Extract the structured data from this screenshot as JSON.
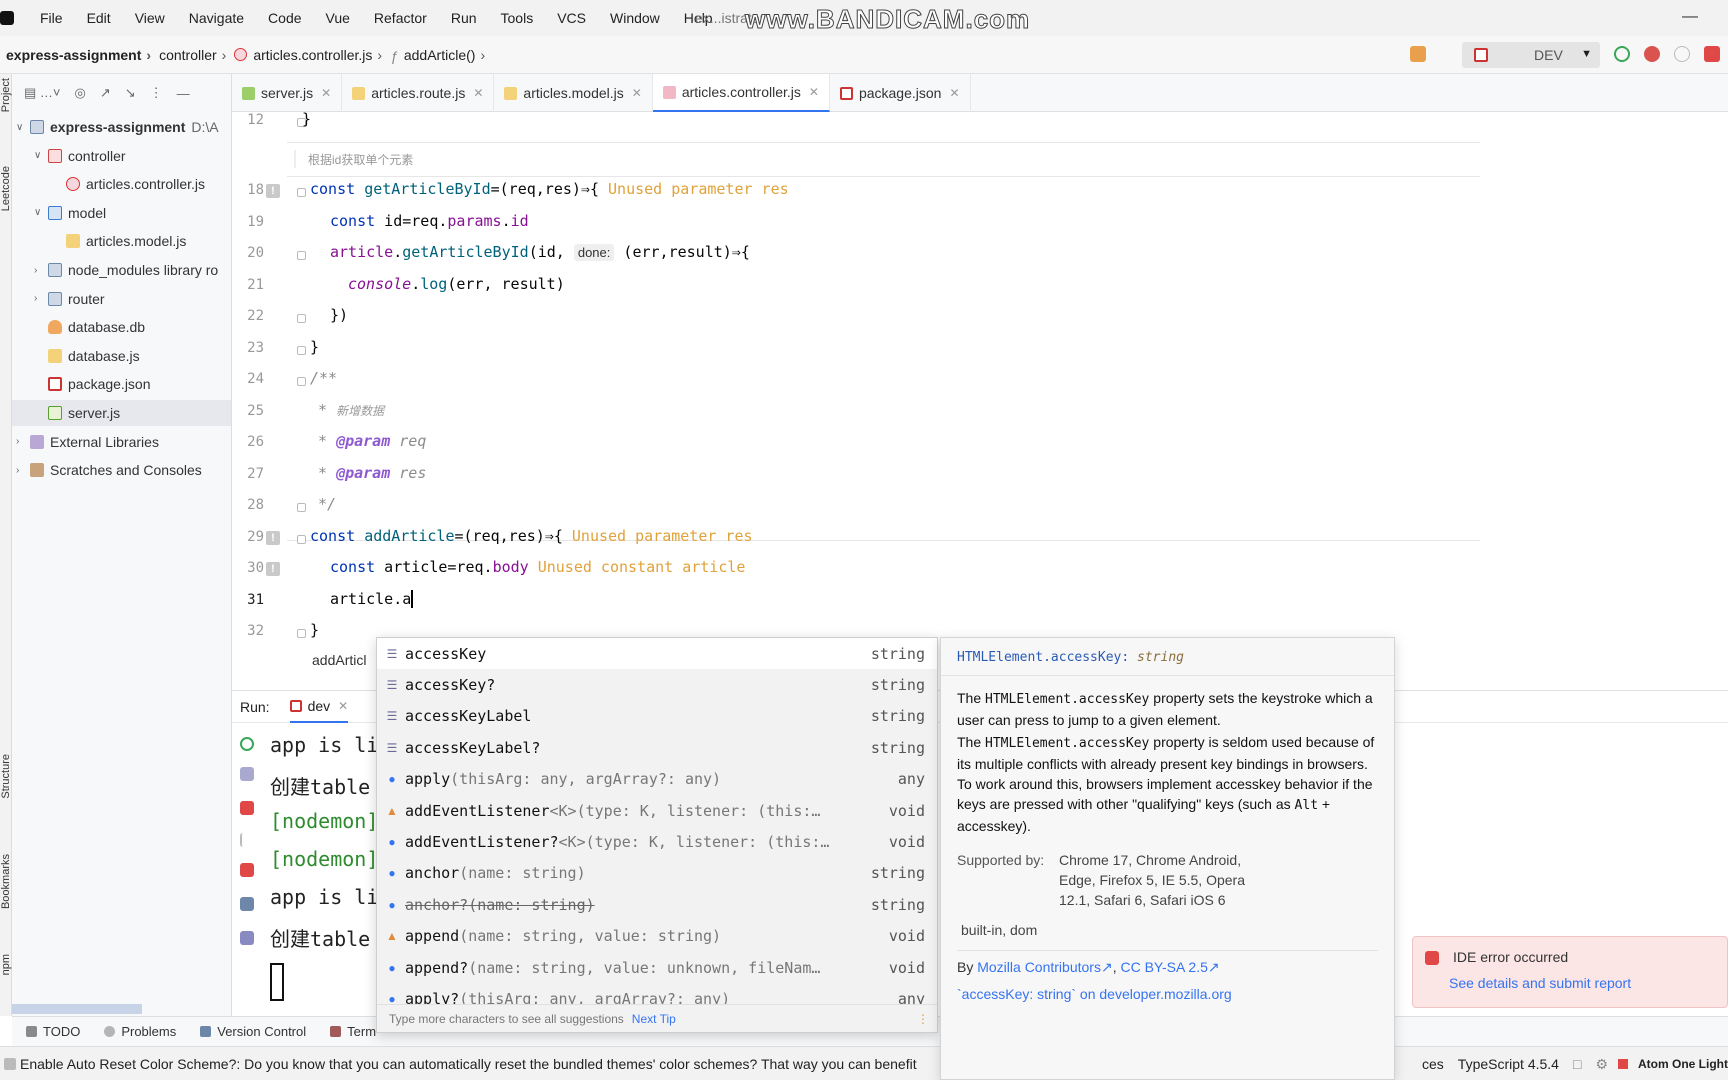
{
  "menu": [
    "File",
    "Edit",
    "View",
    "Navigate",
    "Code",
    "Vue",
    "Refactor",
    "Run",
    "Tools",
    "VCS",
    "Window",
    "Help"
  ],
  "window_title": "ex...istrator",
  "watermark": "www.BANDICAM.com",
  "breadcrumb": {
    "project": "express-assignment",
    "folder": "controller",
    "file": "articles.controller.js",
    "symbol": "addArticle()"
  },
  "run_config": "DEV",
  "project_tree": [
    {
      "label": "express-assignment",
      "suffix": "D:\\A",
      "depth": 0,
      "arrow": "open",
      "icon": "folder"
    },
    {
      "label": "controller",
      "depth": 1,
      "arrow": "open",
      "icon": "folder-red"
    },
    {
      "label": "articles.controller.js",
      "depth": 2,
      "arrow": "",
      "icon": "ng"
    },
    {
      "label": "model",
      "depth": 1,
      "arrow": "open",
      "icon": "folder-blue"
    },
    {
      "label": "articles.model.js",
      "depth": 2,
      "arrow": "",
      "icon": "js"
    },
    {
      "label": "node_modules  library ro",
      "depth": 1,
      "arrow": "closed",
      "icon": "folder"
    },
    {
      "label": "router",
      "depth": 1,
      "arrow": "closed",
      "icon": "folder"
    },
    {
      "label": "database.db",
      "depth": 1,
      "arrow": "",
      "icon": "db"
    },
    {
      "label": "database.js",
      "depth": 1,
      "arrow": "",
      "icon": "js"
    },
    {
      "label": "package.json",
      "depth": 1,
      "arrow": "",
      "icon": "json"
    },
    {
      "label": "server.js",
      "depth": 1,
      "arrow": "",
      "icon": "node"
    },
    {
      "label": "External Libraries",
      "depth": 0,
      "arrow": "closed",
      "icon": "lib"
    },
    {
      "label": "Scratches and Consoles",
      "depth": 0,
      "arrow": "closed",
      "icon": "scr"
    }
  ],
  "left_strip_tabs": [
    "Project",
    "Leetcode",
    "Structure",
    "Bookmarks",
    "npm"
  ],
  "tabs": [
    {
      "label": "server.js",
      "active": false
    },
    {
      "label": "articles.route.js",
      "active": false
    },
    {
      "label": "articles.model.js",
      "active": false
    },
    {
      "label": "articles.controller.js",
      "active": true
    },
    {
      "label": "package.json",
      "active": false
    }
  ],
  "editor": {
    "line_numbers": [
      "12",
      "18",
      "19",
      "20",
      "21",
      "22",
      "23",
      "24",
      "25",
      "26",
      "27",
      "28",
      "29",
      "30",
      "31",
      "32"
    ],
    "comment_cn": "根据id获取单个元素",
    "inlay_done": "done:",
    "hint_unused_res": "Unused parameter res",
    "hint_unused_article": "Unused constant article",
    "doc_cn": "新增数据",
    "breadcrumb_bottom": "addArticl"
  },
  "run": {
    "label": "Run:",
    "tab": "dev",
    "lines": [
      "app is li",
      "创建table",
      "[nodemon]",
      "[nodemon]",
      "app is li",
      "创建table"
    ]
  },
  "completion": {
    "items": [
      {
        "name": "accessKey",
        "tail": "",
        "type": "string",
        "icon": "prop",
        "selected": true
      },
      {
        "name": "accessKey?",
        "tail": "",
        "type": "string",
        "icon": "prop"
      },
      {
        "name": "accessKeyLabel",
        "tail": "",
        "type": "string",
        "icon": "prop"
      },
      {
        "name": "accessKeyLabel?",
        "tail": "",
        "type": "string",
        "icon": "prop"
      },
      {
        "name": "apply",
        "tail": "(thisArg: any, argArray?: any)",
        "type": "any",
        "icon": "method"
      },
      {
        "name": "addEventListener",
        "tail": "<K>(type: K, listener: (this:…",
        "type": "void",
        "icon": "warn"
      },
      {
        "name": "addEventListener?",
        "tail": "<K>(type: K, listener: (this:…",
        "type": "void",
        "icon": "method"
      },
      {
        "name": "anchor",
        "tail": "(name: string)",
        "type": "string",
        "icon": "method"
      },
      {
        "name": "anchor?",
        "tail": "(name: string)",
        "type": "string",
        "icon": "method",
        "strike": true
      },
      {
        "name": "append",
        "tail": "(name: string, value: string)",
        "type": "void",
        "icon": "warn"
      },
      {
        "name": "append?",
        "tail": "(name: string, value: unknown, fileNam…",
        "type": "void",
        "icon": "method"
      },
      {
        "name": "apply?",
        "tail": "(thisArg: any, argArray?: any)",
        "type": "any",
        "icon": "method"
      }
    ],
    "footer": "Type more characters to see all suggestions",
    "tip": "Next Tip"
  },
  "doc": {
    "signature": "HTMLElement.accessKey:",
    "signature_type": "string",
    "para1_pre": "The ",
    "para1_code": "HTMLElement.accessKey",
    "para1_post": " property sets the keystroke which a user can press to jump to a given element.",
    "para2_pre": "The ",
    "para2_code": "HTMLElement.accessKey",
    "para2_post": " property is seldom used because of its multiple conflicts with already present key bindings in browsers. To work around this, browsers implement accesskey behavior if the keys are pressed with other \"qualifying\" keys (such as ",
    "para2_code2": "Alt",
    "para2_end": " + accesskey).",
    "supported_label": "Supported by:",
    "supported_value": "Chrome 17, Chrome Android, Edge, Firefox 5, IE 5.5, Opera 12.1, Safari 6, Safari iOS 6",
    "tags": "built-in, dom",
    "by_label": "By",
    "contributors": "Mozilla Contributors",
    "license": "CC BY-SA 2.5",
    "mdn_link": "`accessKey: string` on developer.mozilla.org"
  },
  "notification": {
    "title": "IDE error occurred",
    "link": "See details and submit report"
  },
  "bottom_tabs": [
    "TODO",
    "Problems",
    "Version Control",
    "Term"
  ],
  "status": {
    "message": "Enable Auto Reset Color Scheme?: Do you know that you can automatically reset the bundled themes' color schemes? That way you can benefit",
    "right_ces": "ces",
    "typescript": "TypeScript 4.5.4",
    "theme": "Atom One Light"
  },
  "colors": {
    "accent": "#3574f0",
    "keyword": "#0033b3",
    "warning": "#e0a23a",
    "error": "#e04848"
  }
}
